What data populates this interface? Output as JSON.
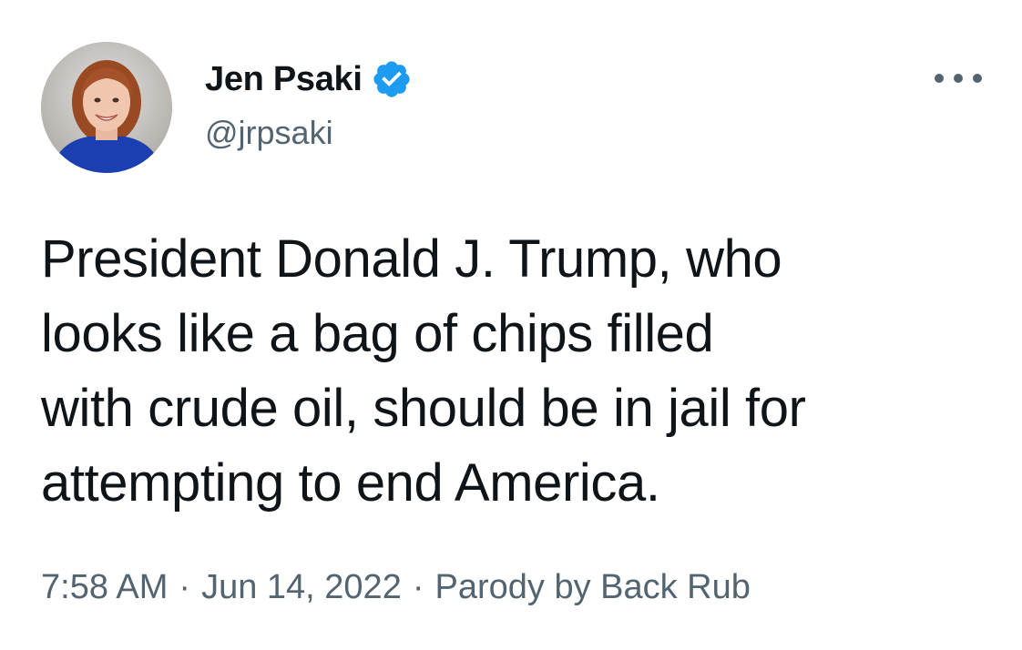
{
  "author": {
    "display_name": "Jen Psaki",
    "handle": "@jrpsaki",
    "verified": true,
    "avatar_icon": "profile-photo"
  },
  "tweet": {
    "lines": [
      "President Donald J. Trump, who",
      "looks like a bag of chips filled",
      "with crude oil, should be in jail for",
      "attempting to end America."
    ]
  },
  "meta": {
    "time": "7:58 AM",
    "separator": "·",
    "date": "Jun 14, 2022",
    "source": "Parody by Back Rub"
  },
  "icons": {
    "verified": "verified-badge-icon",
    "more": "more-options-icon"
  },
  "colors": {
    "text": "#0f1419",
    "secondary": "#536471",
    "verified": "#1d9bf0"
  }
}
